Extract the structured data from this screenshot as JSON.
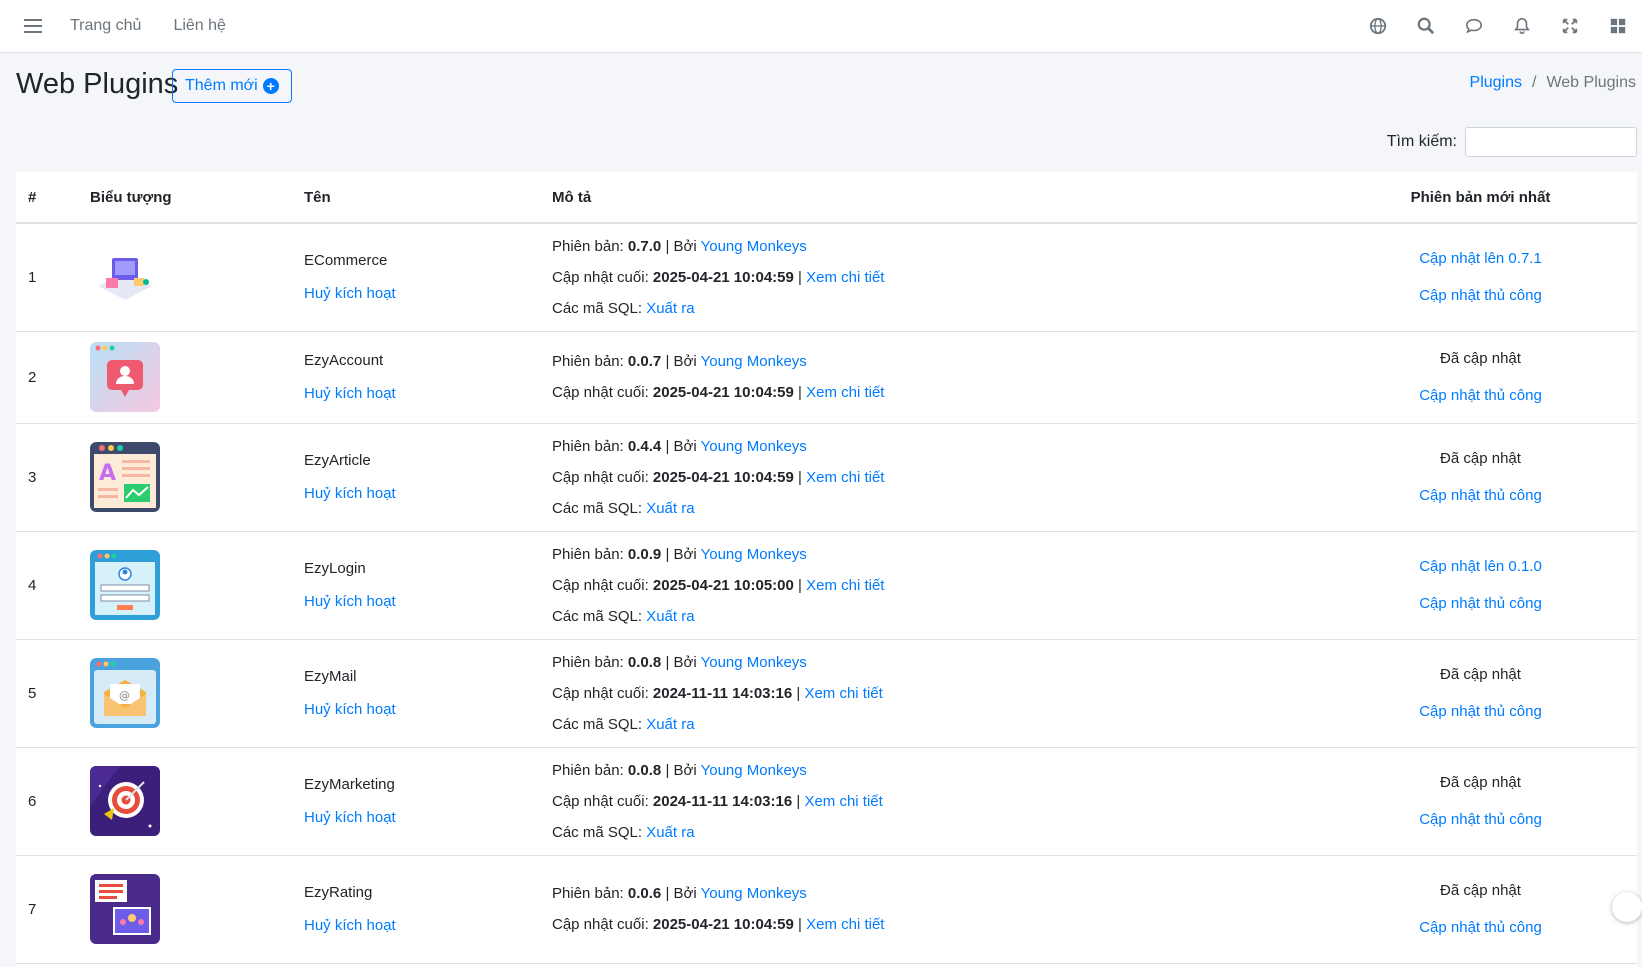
{
  "nav": {
    "links": [
      "Trang chủ",
      "Liên hệ"
    ],
    "icons": [
      "globe-icon",
      "search-icon",
      "comments-icon",
      "bell-icon",
      "expand-icon",
      "apps-grid-icon"
    ]
  },
  "header": {
    "title": "Web Plugins",
    "add_label": "Thêm mới",
    "breadcrumb_root": "Plugins",
    "breadcrumb_sep": "/",
    "breadcrumb_current": "Web Plugins"
  },
  "search": {
    "label": "Tìm kiếm:",
    "value": "",
    "placeholder": ""
  },
  "table": {
    "headers": {
      "num": "#",
      "icon": "Biểu tượng",
      "name": "Tên",
      "desc": "Mô tả",
      "latest": "Phiên bản mới nhất"
    },
    "labels": {
      "version": "Phiên bản:",
      "by": "| Bởi",
      "updated": "Cập nhật cuối:",
      "pipe": "|",
      "details": "Xem chi tiết",
      "sql": "Các mã SQL:",
      "export": "Xuất ra",
      "deactivate": "Huỷ kích hoạt",
      "manual_update": "Cập nhật thủ công"
    },
    "rows": [
      {
        "num": "1",
        "name": "ECommerce",
        "version": "0.7.0",
        "author": "Young Monkeys",
        "updated": "2025-04-21 10:04:59",
        "has_sql": true,
        "latest": "Cập nhật lên 0.7.1",
        "latest_is_link": true,
        "icon": "ecommerce-icon"
      },
      {
        "num": "2",
        "name": "EzyAccount",
        "version": "0.0.7",
        "author": "Young Monkeys",
        "updated": "2025-04-21 10:04:59",
        "has_sql": false,
        "latest": "Đã cập nhật",
        "latest_is_link": false,
        "icon": "account-icon"
      },
      {
        "num": "3",
        "name": "EzyArticle",
        "version": "0.4.4",
        "author": "Young Monkeys",
        "updated": "2025-04-21 10:04:59",
        "has_sql": true,
        "latest": "Đã cập nhật",
        "latest_is_link": false,
        "icon": "article-icon"
      },
      {
        "num": "4",
        "name": "EzyLogin",
        "version": "0.0.9",
        "author": "Young Monkeys",
        "updated": "2025-04-21 10:05:00",
        "has_sql": true,
        "latest": "Cập nhật lên 0.1.0",
        "latest_is_link": true,
        "icon": "login-icon"
      },
      {
        "num": "5",
        "name": "EzyMail",
        "version": "0.0.8",
        "author": "Young Monkeys",
        "updated": "2024-11-11 14:03:16",
        "has_sql": true,
        "latest": "Đã cập nhật",
        "latest_is_link": false,
        "icon": "mail-icon"
      },
      {
        "num": "6",
        "name": "EzyMarketing",
        "version": "0.0.8",
        "author": "Young Monkeys",
        "updated": "2024-11-11 14:03:16",
        "has_sql": true,
        "latest": "Đã cập nhật",
        "latest_is_link": false,
        "icon": "marketing-icon"
      },
      {
        "num": "7",
        "name": "EzyRating",
        "version": "0.0.6",
        "author": "Young Monkeys",
        "updated": "2025-04-21 10:04:59",
        "has_sql": false,
        "latest": "Đã cập nhật",
        "latest_is_link": false,
        "icon": "rating-icon"
      }
    ]
  },
  "colors": {
    "link": "#007bff",
    "background": "#f4f6f9",
    "text": "#212529"
  }
}
